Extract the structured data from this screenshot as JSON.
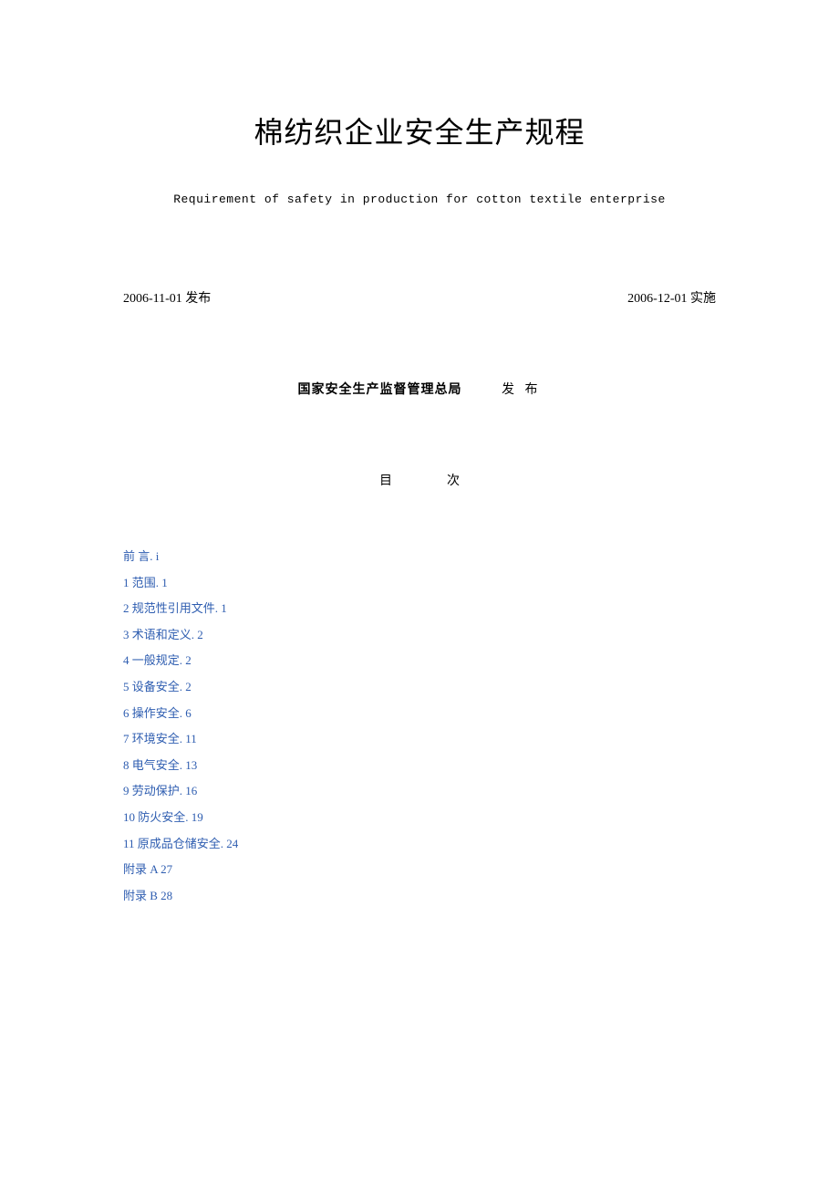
{
  "title_main": "棉纺织企业安全生产规程",
  "subtitle_en": "Requirement of safety in production for cotton textile enterprise",
  "date_publish": "2006-11-01 发布",
  "date_effective": "2006-12-01 实施",
  "publisher_name": "国家安全生产监督管理总局",
  "publisher_action": "发 布",
  "toc_heading": "目次",
  "toc": [
    {
      "raw": "前    言. i"
    },
    {
      "raw": "1  范围. 1"
    },
    {
      "raw": "2  规范性引用文件. 1"
    },
    {
      "raw": "3  术语和定义. 2"
    },
    {
      "raw": "4  一般规定. 2"
    },
    {
      "raw": "5  设备安全. 2"
    },
    {
      "raw": "6  操作安全. 6"
    },
    {
      "raw": "7  环境安全. 11"
    },
    {
      "raw": "8  电气安全. 13"
    },
    {
      "raw": "9  劳动保护. 16"
    },
    {
      "raw": "10  防火安全. 19"
    },
    {
      "raw": "11  原成品仓储安全. 24"
    },
    {
      "raw": "附录 A 27"
    },
    {
      "raw": "附录 B 28"
    }
  ]
}
